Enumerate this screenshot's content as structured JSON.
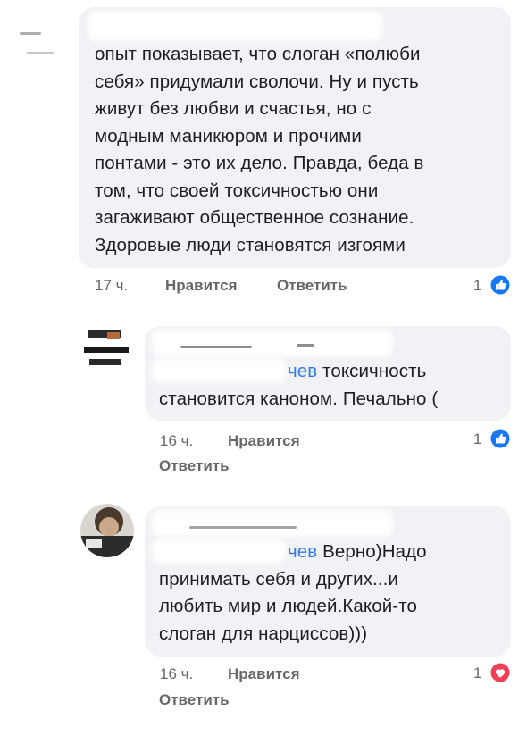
{
  "comments": [
    {
      "text_lines": [
        "опыт показывает, что слоган «полюби",
        "себя» придумали сволочи. Ну и пусть",
        "живут без любви и счастья, но с",
        "модным маникюром и прочими",
        "понтами - это их дело. Правда, беда в",
        "том, что своей токсичностью они",
        "загаживают общественное сознание.",
        "Здоровые люди становятся изгоями"
      ],
      "time": "17 ч.",
      "like_label": "Нравится",
      "reply_label": "Ответить",
      "reaction_count": "1",
      "reaction": "like"
    },
    {
      "mention": "чев",
      "text_first": " токсичность",
      "text_lines": [
        "становится  каноном. Печально ("
      ],
      "time": "16 ч.",
      "like_label": "Нравится",
      "reply_label": "Ответить",
      "reaction_count": "1",
      "reaction": "like"
    },
    {
      "mention": "чев",
      "text_first": " Верно)Надо",
      "text_lines": [
        "принимать себя и других...и",
        "любить мир и людей.Какой-то",
        "слоган для нарциссов)))"
      ],
      "time": "16 ч.",
      "like_label": "Нравится",
      "reply_label": "Ответить",
      "reaction_count": "1",
      "reaction": "love"
    }
  ],
  "colors": {
    "bubble": "#f0f2f5",
    "mention": "#3578e5",
    "meta": "#65676b",
    "like": "#1877f2",
    "love": "#f33e58"
  }
}
